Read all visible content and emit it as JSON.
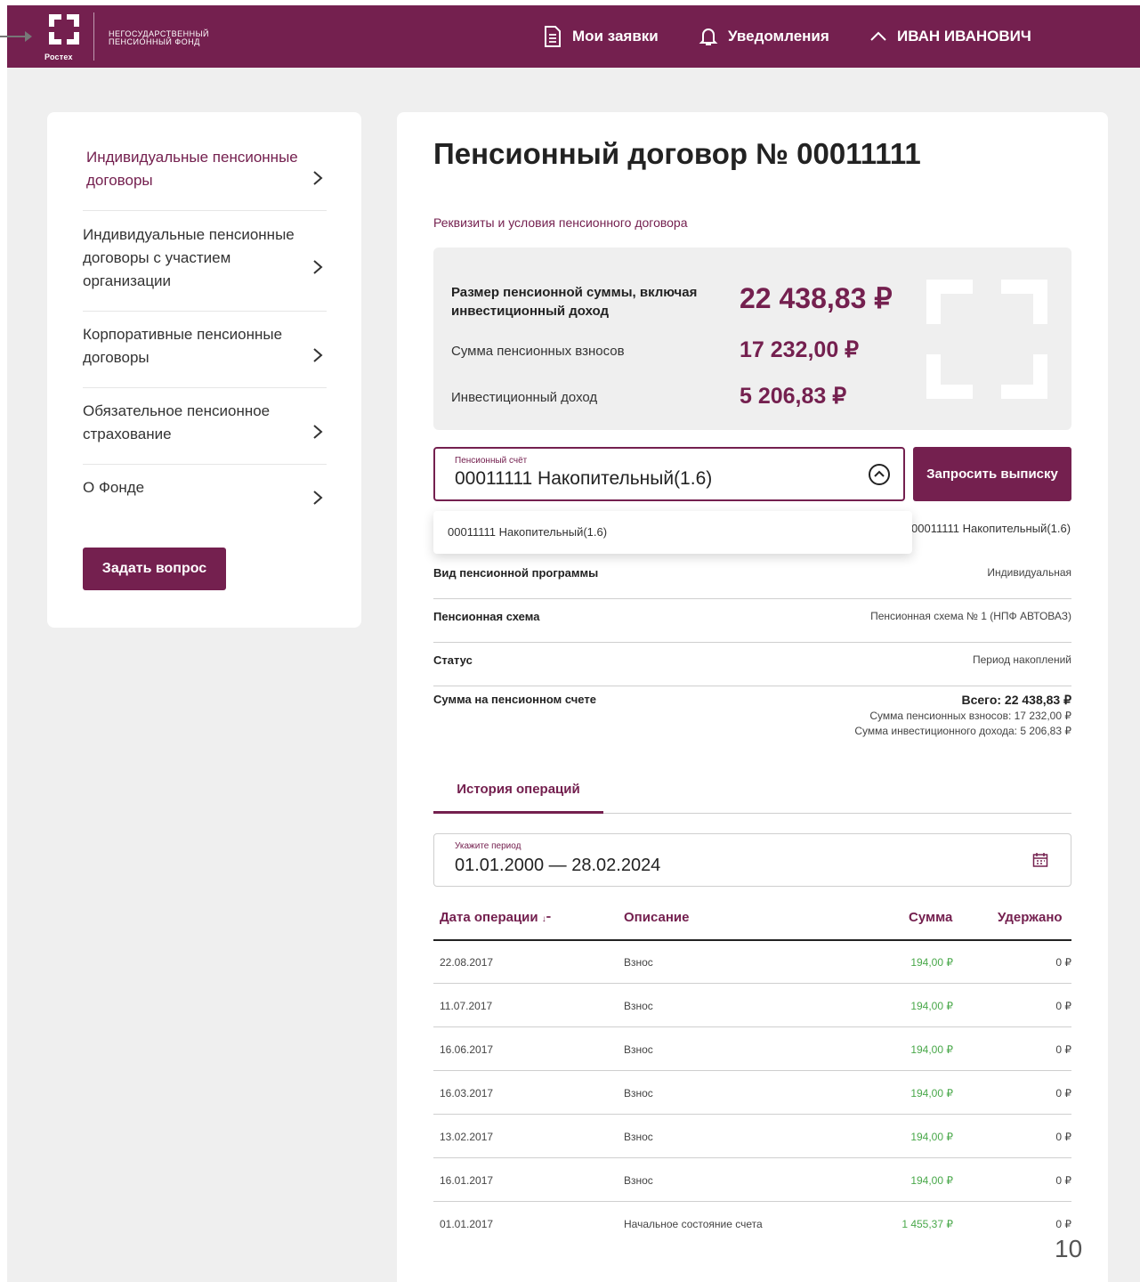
{
  "header": {
    "logo_text": "Ростех",
    "fund_name": "НЕГОСУДАРСТВЕННЫЙ ПЕНСИОННЫЙ ФОНД",
    "applications": "Мои заявки",
    "notifications": "Уведомления",
    "user": "ИВАН ИВАНОВИЧ"
  },
  "sidebar": {
    "items": [
      {
        "label": "Индивидуальные пенсионные договоры"
      },
      {
        "label": "Индивидуальные пенсионные договоры с участием организации"
      },
      {
        "label": "Корпоративные пенсионные договоры"
      },
      {
        "label": "Обязательное пенсионное страхование"
      },
      {
        "label": "О Фонде"
      }
    ],
    "ask_button": "Задать вопрос"
  },
  "contract": {
    "title": "Пенсионный договор № 00011111",
    "subtitle": "Реквизиты и условия пенсионного договора",
    "summary": {
      "total_label": "Размер пенсионной суммы, включая инвестиционный доход",
      "total_value": "22 438,83 ₽",
      "contributions_label": "Сумма пенсионных взносов",
      "contributions_value": "17 232,00 ₽",
      "income_label": "Инвестиционный доход",
      "income_value": "5 206,83 ₽"
    },
    "account": {
      "label": "Пенсионный счёт",
      "value": "00011111 Накопительный(1.6)",
      "dropdown_option": "00011111 Накопительный(1.6)",
      "underlying_value": "00011111 Накопительный(1.6)"
    },
    "request_button": "Запросить выписку",
    "details": [
      {
        "name": "Вид пенсионной программы",
        "value": "Индивидуальная"
      },
      {
        "name": "Пенсионная схема",
        "value": "Пенсионная схема № 1 (НПФ АВТОВАЗ)"
      },
      {
        "name": "Статус",
        "value": "Период накоплений"
      }
    ],
    "account_sum": {
      "name": "Сумма на пенсионном счете",
      "total": "Всего: 22 438,83 ₽",
      "contributions": "Сумма пенсионных взносов: 17 232,00 ₽",
      "income": "Сумма инвестиционного дохода: 5 206,83 ₽"
    },
    "tab": "История операций",
    "period": {
      "label": "Укажите период",
      "value": "01.01.2000 — 28.02.2024"
    },
    "table": {
      "headers": [
        "Дата операции",
        "Описание",
        "Сумма",
        "Удержано"
      ],
      "rows": [
        {
          "date": "22.08.2017",
          "description": "Взнос",
          "amount": "194,00 ₽",
          "held": "0 ₽"
        },
        {
          "date": "11.07.2017",
          "description": "Взнос",
          "amount": "194,00 ₽",
          "held": "0 ₽"
        },
        {
          "date": "16.06.2017",
          "description": "Взнос",
          "amount": "194,00 ₽",
          "held": "0 ₽"
        },
        {
          "date": "16.03.2017",
          "description": "Взнос",
          "amount": "194,00 ₽",
          "held": "0 ₽"
        },
        {
          "date": "13.02.2017",
          "description": "Взнос",
          "amount": "194,00 ₽",
          "held": "0 ₽"
        },
        {
          "date": "16.01.2017",
          "description": "Взнос",
          "amount": "194,00 ₽",
          "held": "0 ₽"
        },
        {
          "date": "01.01.2017",
          "description": "Начальное состояние счета",
          "amount": "1 455,37 ₽",
          "held": "0 ₽"
        }
      ]
    }
  },
  "page_number": "10",
  "colors": {
    "brand": "#74204f",
    "amount": "#49a84a",
    "background": "#efefef"
  }
}
